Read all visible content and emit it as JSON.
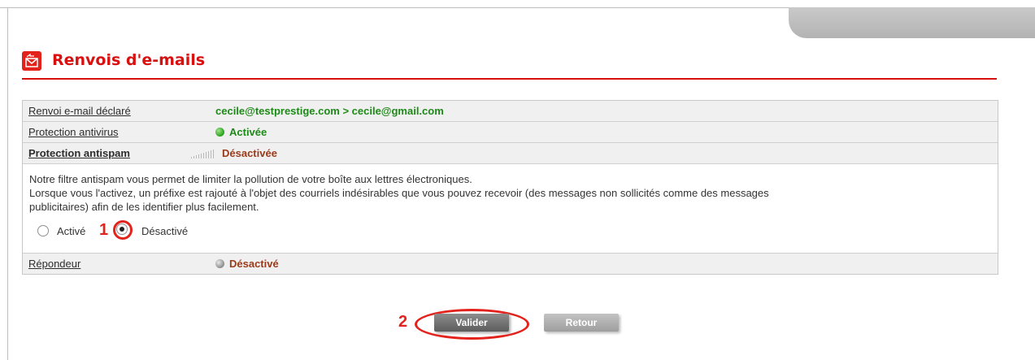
{
  "header": {
    "title": "Renvois d'e-mails",
    "icon": "email-forward-icon"
  },
  "rows": [
    {
      "label": "Renvoi e-mail déclaré",
      "value": "cecile@testprestige.com > cecile@gmail.com",
      "status_color": "#1d8a17"
    },
    {
      "label": "Protection antivirus",
      "value": "Activée",
      "status_color": "#1d8a17"
    },
    {
      "label": "Protection antispam",
      "value": "Désactivée",
      "status_color": "#9a3a1a"
    }
  ],
  "antispam": {
    "description": [
      "Notre filtre antispam vous permet de limiter la pollution de votre boîte aux lettres électroniques.",
      "Lorsque vous l'activez, un préfixe est rajouté à l'objet des courriels indésirables que vous pouvez recevoir (des messages non sollicités comme des messages",
      "publicitaires) afin de les identifier plus facilement."
    ],
    "option_active": "Activé",
    "option_inactive": "Désactivé",
    "selected": "Désactivé"
  },
  "repondeur": {
    "label": "Répondeur",
    "value": "Désactivé",
    "status_color": "#9a3a1a"
  },
  "buttons": {
    "valider": "Valider",
    "retour": "Retour"
  },
  "annotations": {
    "step1": "1",
    "step2": "2",
    "color": "#e3231b"
  }
}
